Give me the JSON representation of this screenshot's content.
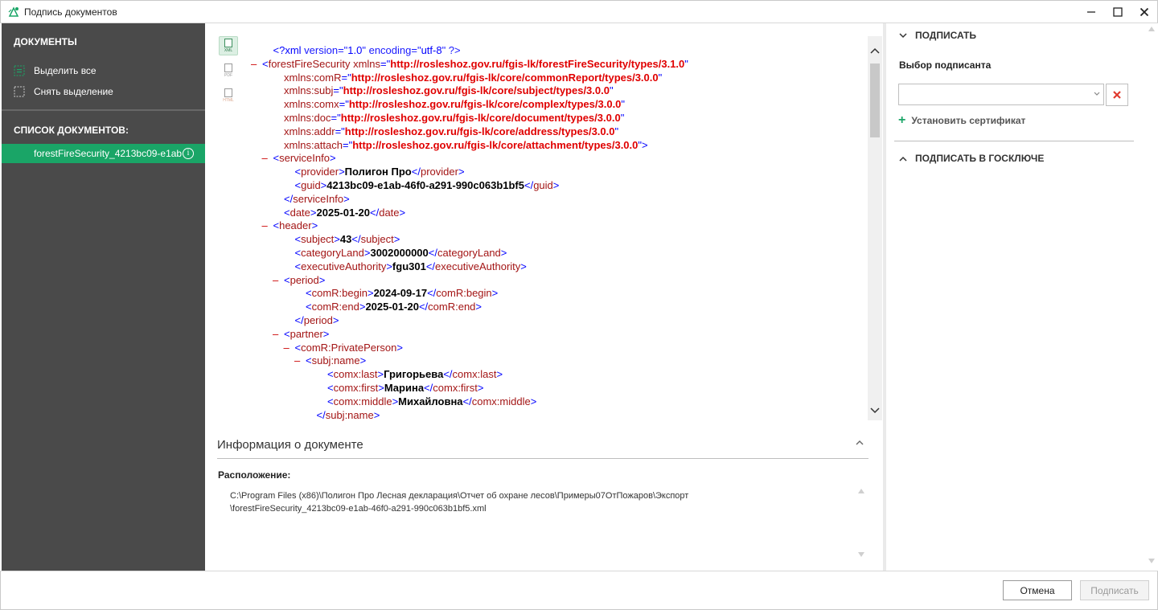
{
  "window": {
    "title": "Подпись документов"
  },
  "sidebar": {
    "documents_title": "ДОКУМЕНТЫ",
    "select_all": "Выделить все",
    "deselect": "Снять выделение",
    "list_title": "СПИСОК ДОКУМЕНТОВ:",
    "items": [
      {
        "label": "forestFireSecurity_4213bc09-e1ab",
        "selected": true
      }
    ],
    "accent_color": "#1aa567",
    "bg_color": "#4a4a4a"
  },
  "format_tabs": [
    {
      "label": "XML",
      "active": true
    },
    {
      "label": "PDF",
      "active": false
    },
    {
      "label": "HTML",
      "active": false
    }
  ],
  "xml": {
    "lines": [
      {
        "indent": 1,
        "toggle": "",
        "segments": [
          [
            "b",
            "<?xml "
          ],
          [
            "v",
            "version=\""
          ],
          [
            "b",
            "1.0"
          ],
          [
            "v",
            "\" encoding=\""
          ],
          [
            "b",
            "utf-8"
          ],
          [
            "v",
            "\" ?>"
          ]
        ]
      },
      {
        "indent": 0,
        "toggle": "–",
        "segments": [
          [
            "b",
            "<"
          ],
          [
            "t",
            "forestFireSecurity"
          ],
          [
            "a",
            " xmlns"
          ],
          [
            "b",
            "=\""
          ],
          [
            "av",
            "http://rosleshoz.gov.ru/fgis-lk/forestFireSecurity/types/3.1.0"
          ],
          [
            "b",
            "\""
          ]
        ]
      },
      {
        "indent": 2,
        "toggle": "",
        "segments": [
          [
            "a",
            "xmlns:comR"
          ],
          [
            "b",
            "=\""
          ],
          [
            "av",
            "http://rosleshoz.gov.ru/fgis-lk/core/commonReport/types/3.0.0"
          ],
          [
            "b",
            "\""
          ]
        ]
      },
      {
        "indent": 2,
        "toggle": "",
        "segments": [
          [
            "a",
            "xmlns:subj"
          ],
          [
            "b",
            "=\""
          ],
          [
            "av",
            "http://rosleshoz.gov.ru/fgis-lk/core/subject/types/3.0.0"
          ],
          [
            "b",
            "\""
          ]
        ]
      },
      {
        "indent": 2,
        "toggle": "",
        "segments": [
          [
            "a",
            "xmlns:comx"
          ],
          [
            "b",
            "=\""
          ],
          [
            "av",
            "http://rosleshoz.gov.ru/fgis-lk/core/complex/types/3.0.0"
          ],
          [
            "b",
            "\""
          ]
        ]
      },
      {
        "indent": 2,
        "toggle": "",
        "segments": [
          [
            "a",
            "xmlns:doc"
          ],
          [
            "b",
            "=\""
          ],
          [
            "av",
            "http://rosleshoz.gov.ru/fgis-lk/core/document/types/3.0.0"
          ],
          [
            "b",
            "\""
          ]
        ]
      },
      {
        "indent": 2,
        "toggle": "",
        "segments": [
          [
            "a",
            "xmlns:addr"
          ],
          [
            "b",
            "=\""
          ],
          [
            "av",
            "http://rosleshoz.gov.ru/fgis-lk/core/address/types/3.0.0"
          ],
          [
            "b",
            "\""
          ]
        ]
      },
      {
        "indent": 2,
        "toggle": "",
        "segments": [
          [
            "a",
            "xmlns:attach"
          ],
          [
            "b",
            "=\""
          ],
          [
            "av",
            "http://rosleshoz.gov.ru/fgis-lk/core/attachment/types/3.0.0"
          ],
          [
            "b",
            "\">"
          ]
        ]
      },
      {
        "indent": 1,
        "toggle": "–",
        "segments": [
          [
            "b",
            "<"
          ],
          [
            "t",
            "serviceInfo"
          ],
          [
            "b",
            ">"
          ]
        ]
      },
      {
        "indent": 3,
        "toggle": "",
        "segments": [
          [
            "b",
            "<"
          ],
          [
            "t",
            "provider"
          ],
          [
            "b",
            ">"
          ],
          [
            "tx",
            "Полигон Про"
          ],
          [
            "b",
            "</"
          ],
          [
            "t",
            "provider"
          ],
          [
            "b",
            ">"
          ]
        ]
      },
      {
        "indent": 3,
        "toggle": "",
        "segments": [
          [
            "b",
            "<"
          ],
          [
            "t",
            "guid"
          ],
          [
            "b",
            ">"
          ],
          [
            "tx",
            "4213bc09-e1ab-46f0-a291-990c063b1bf5"
          ],
          [
            "b",
            "</"
          ],
          [
            "t",
            "guid"
          ],
          [
            "b",
            ">"
          ]
        ]
      },
      {
        "indent": 2,
        "toggle": "",
        "segments": [
          [
            "b",
            "</"
          ],
          [
            "t",
            "serviceInfo"
          ],
          [
            "b",
            ">"
          ]
        ]
      },
      {
        "indent": 2,
        "toggle": "",
        "segments": [
          [
            "b",
            "<"
          ],
          [
            "t",
            "date"
          ],
          [
            "b",
            ">"
          ],
          [
            "tx",
            "2025-01-20"
          ],
          [
            "b",
            "</"
          ],
          [
            "t",
            "date"
          ],
          [
            "b",
            ">"
          ]
        ]
      },
      {
        "indent": 1,
        "toggle": "–",
        "segments": [
          [
            "b",
            "<"
          ],
          [
            "t",
            "header"
          ],
          [
            "b",
            ">"
          ]
        ]
      },
      {
        "indent": 3,
        "toggle": "",
        "segments": [
          [
            "b",
            "<"
          ],
          [
            "t",
            "subject"
          ],
          [
            "b",
            ">"
          ],
          [
            "tx",
            "43"
          ],
          [
            "b",
            "</"
          ],
          [
            "t",
            "subject"
          ],
          [
            "b",
            ">"
          ]
        ]
      },
      {
        "indent": 3,
        "toggle": "",
        "segments": [
          [
            "b",
            "<"
          ],
          [
            "t",
            "categoryLand"
          ],
          [
            "b",
            ">"
          ],
          [
            "tx",
            "3002000000"
          ],
          [
            "b",
            "</"
          ],
          [
            "t",
            "categoryLand"
          ],
          [
            "b",
            ">"
          ]
        ]
      },
      {
        "indent": 3,
        "toggle": "",
        "segments": [
          [
            "b",
            "<"
          ],
          [
            "t",
            "executiveAuthority"
          ],
          [
            "b",
            ">"
          ],
          [
            "tx",
            "fgu301"
          ],
          [
            "b",
            "</"
          ],
          [
            "t",
            "executiveAuthority"
          ],
          [
            "b",
            ">"
          ]
        ]
      },
      {
        "indent": 2,
        "toggle": "–",
        "segments": [
          [
            "b",
            "<"
          ],
          [
            "t",
            "period"
          ],
          [
            "b",
            ">"
          ]
        ]
      },
      {
        "indent": 4,
        "toggle": "",
        "segments": [
          [
            "b",
            "<"
          ],
          [
            "t",
            "comR:begin"
          ],
          [
            "b",
            ">"
          ],
          [
            "tx",
            "2024-09-17"
          ],
          [
            "b",
            "</"
          ],
          [
            "t",
            "comR:begin"
          ],
          [
            "b",
            ">"
          ]
        ]
      },
      {
        "indent": 4,
        "toggle": "",
        "segments": [
          [
            "b",
            "<"
          ],
          [
            "t",
            "comR:end"
          ],
          [
            "b",
            ">"
          ],
          [
            "tx",
            "2025-01-20"
          ],
          [
            "b",
            "</"
          ],
          [
            "t",
            "comR:end"
          ],
          [
            "b",
            ">"
          ]
        ]
      },
      {
        "indent": 3,
        "toggle": "",
        "segments": [
          [
            "b",
            "</"
          ],
          [
            "t",
            "period"
          ],
          [
            "b",
            ">"
          ]
        ]
      },
      {
        "indent": 2,
        "toggle": "–",
        "segments": [
          [
            "b",
            "<"
          ],
          [
            "t",
            "partner"
          ],
          [
            "b",
            ">"
          ]
        ]
      },
      {
        "indent": 3,
        "toggle": "–",
        "segments": [
          [
            "b",
            "<"
          ],
          [
            "t",
            "comR:PrivatePerson"
          ],
          [
            "b",
            ">"
          ]
        ]
      },
      {
        "indent": 4,
        "toggle": "–",
        "segments": [
          [
            "b",
            "<"
          ],
          [
            "t",
            "subj:name"
          ],
          [
            "b",
            ">"
          ]
        ]
      },
      {
        "indent": 6,
        "toggle": "",
        "segments": [
          [
            "b",
            "<"
          ],
          [
            "t",
            "comx:last"
          ],
          [
            "b",
            ">"
          ],
          [
            "tx",
            "Григорьева"
          ],
          [
            "b",
            "</"
          ],
          [
            "t",
            "comx:last"
          ],
          [
            "b",
            ">"
          ]
        ]
      },
      {
        "indent": 6,
        "toggle": "",
        "segments": [
          [
            "b",
            "<"
          ],
          [
            "t",
            "comx:first"
          ],
          [
            "b",
            ">"
          ],
          [
            "tx",
            "Марина"
          ],
          [
            "b",
            "</"
          ],
          [
            "t",
            "comx:first"
          ],
          [
            "b",
            ">"
          ]
        ]
      },
      {
        "indent": 6,
        "toggle": "",
        "segments": [
          [
            "b",
            "<"
          ],
          [
            "t",
            "comx:middle"
          ],
          [
            "b",
            ">"
          ],
          [
            "tx",
            "Михайловна"
          ],
          [
            "b",
            "</"
          ],
          [
            "t",
            "comx:middle"
          ],
          [
            "b",
            ">"
          ]
        ]
      },
      {
        "indent": 5,
        "toggle": "",
        "segments": [
          [
            "b",
            "</"
          ],
          [
            "t",
            "subj:name"
          ],
          [
            "b",
            ">"
          ]
        ]
      }
    ]
  },
  "doc_info": {
    "title": "Информация о документе",
    "location_label": "Расположение:",
    "path_line1": "C:\\Program Files (x86)\\Полигон Про Лесная декларация\\Отчет об охране лесов\\Примеры07ОтПожаров\\Экспорт",
    "path_line2": "\\forestFireSecurity_4213bc09-e1ab-46f0-a291-990c063b1bf5.xml"
  },
  "right_panel": {
    "sign_title": "ПОДПИСАТЬ",
    "signer_label": "Выбор подписанта",
    "signer_value": "",
    "install_cert": "Установить сертификат",
    "goskey_title": "ПОДПИСАТЬ В ГОСКЛЮЧЕ"
  },
  "buttons": {
    "cancel": "Отмена",
    "sign": "Подписать"
  }
}
